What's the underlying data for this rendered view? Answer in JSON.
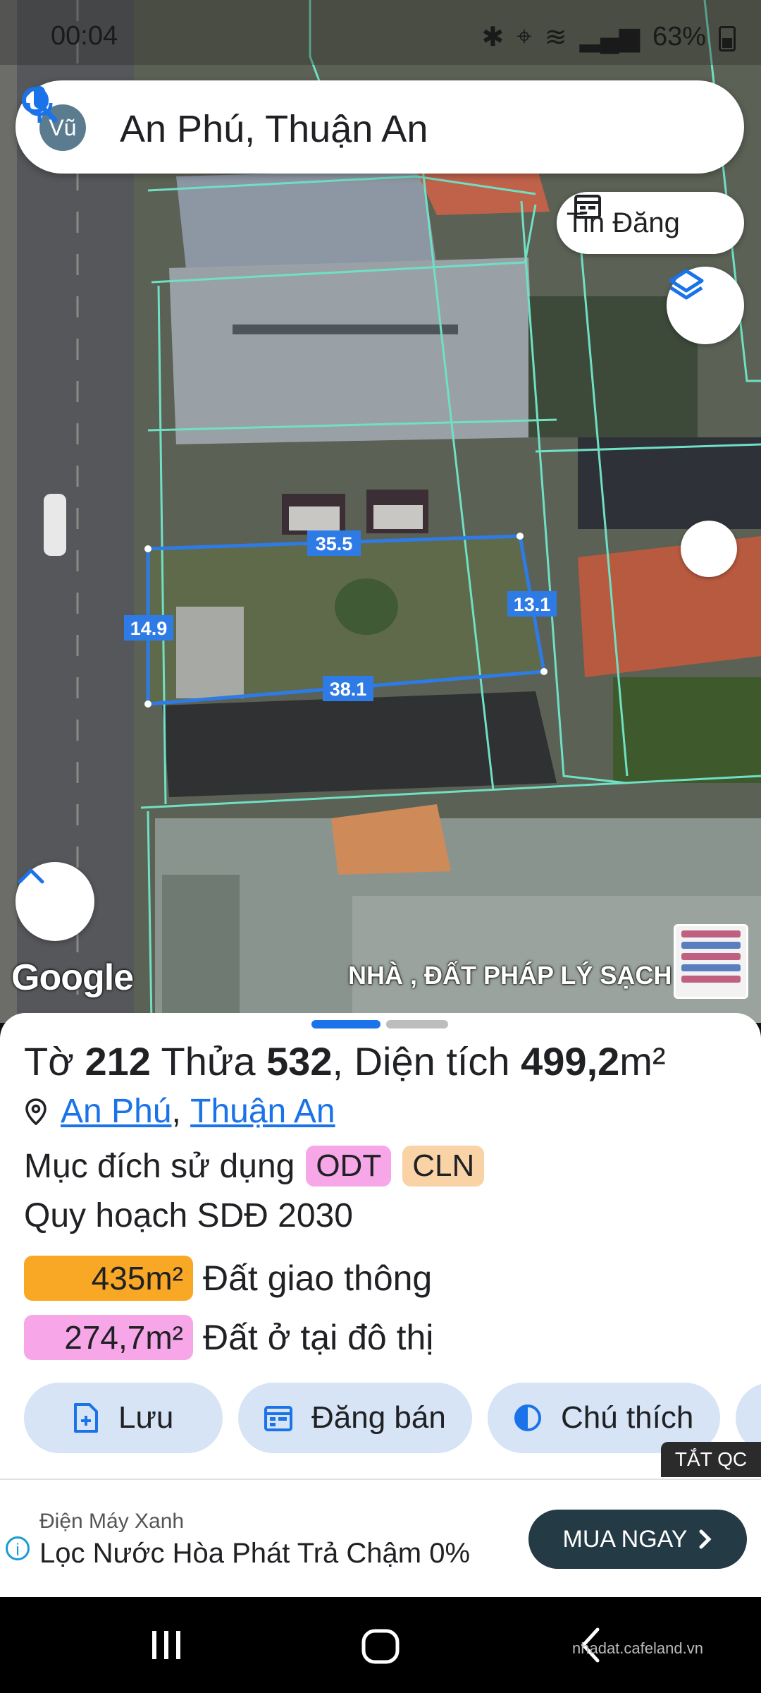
{
  "status_bar": {
    "time": "00:04",
    "battery": "63%"
  },
  "search": {
    "avatar_initials": "Vũ",
    "query": "An Phú, Thuận An"
  },
  "map": {
    "listing_button_label": "Tin Đăng",
    "google_logo": "Google",
    "ad_overlay": "NHÀ , ĐẤT PHÁP LÝ SẠCH",
    "parcel_sides": [
      "35.5",
      "13.1",
      "38.1",
      "14.9"
    ]
  },
  "parcel": {
    "sheet_label": "Tờ",
    "sheet_number": "212",
    "plot_label": "Thửa",
    "plot_number": "532",
    "area_label": ", Diện tích",
    "area_value": "499,2",
    "area_unit": "m²",
    "ward": "An Phú",
    "district": "Thuận An",
    "purpose_label": "Mục đích sử dụng",
    "purpose_tags": [
      {
        "code": "ODT",
        "color": "#f7a6e8"
      },
      {
        "code": "CLN",
        "color": "#f9d3a6"
      }
    ],
    "plan_label": "Quy hoạch SDĐ 2030",
    "zones": [
      {
        "area": "435m²",
        "label": "Đất giao thông",
        "color": "#f9a825"
      },
      {
        "area": "274,7m²",
        "label": "Đất ở tại đô thị",
        "color": "#f7a6e8"
      }
    ]
  },
  "actions": [
    {
      "label": "Lưu",
      "icon": "add-file-icon"
    },
    {
      "label": "Đăng bán",
      "icon": "calendar-icon"
    },
    {
      "label": "Chú thích",
      "icon": "contrast-icon"
    }
  ],
  "hide_ads_label": "TẮT QC",
  "ad": {
    "brand": "Điện Máy Xanh",
    "text": "Lọc Nước Hòa Phát Trả Chậm 0%",
    "cta": "MUA NGAY"
  },
  "watermark": "nhadat.cafeland.vn",
  "colors": {
    "accent": "#1a73e8",
    "chip_bg": "#d6e4f5",
    "parcel_line": "#2f7be5",
    "boundary": "#6fe0c4"
  }
}
